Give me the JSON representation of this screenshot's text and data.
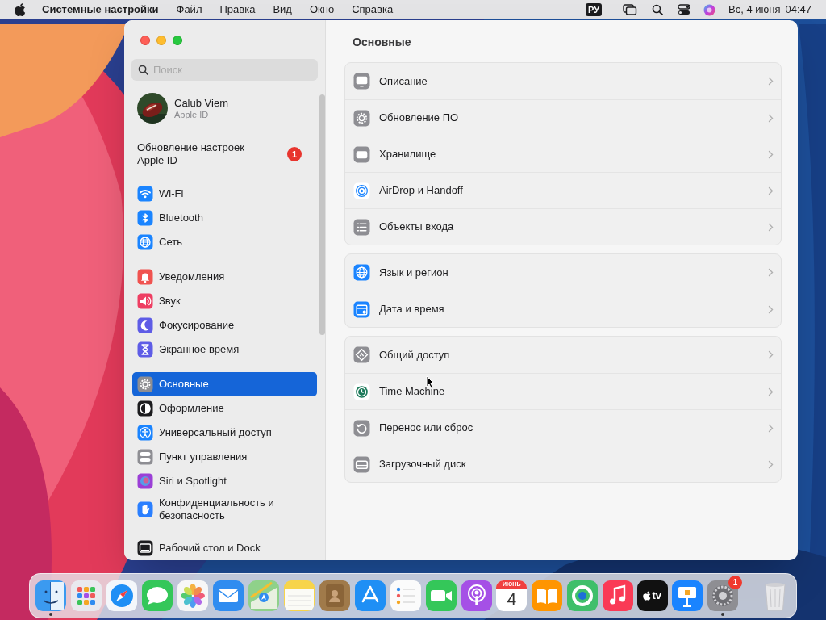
{
  "menu_bar": {
    "app_name": "Системные настройки",
    "menus": [
      "Файл",
      "Правка",
      "Вид",
      "Окно",
      "Справка"
    ],
    "input_source": "РУ",
    "date": "Вс, 4 июня",
    "time": "04:47"
  },
  "sidebar": {
    "search": {
      "placeholder": "Поиск"
    },
    "account": {
      "name": "Calub Viem",
      "subtitle": "Apple ID"
    },
    "notice": {
      "text": "Обновление настроек Apple ID",
      "badge": "1"
    },
    "groups": [
      [
        {
          "label": "Wi-Fi",
          "selected": false,
          "color": "#1a84ff"
        },
        {
          "label": "Bluetooth",
          "selected": false,
          "color": "#1a84ff"
        },
        {
          "label": "Сеть",
          "selected": false,
          "color": "#1a84ff"
        }
      ],
      [
        {
          "label": "Уведомления",
          "selected": false,
          "color": "#f0524f"
        },
        {
          "label": "Звук",
          "selected": false,
          "color": "#ee3e62"
        },
        {
          "label": "Фокусирование",
          "selected": false,
          "color": "#5e5ce6"
        },
        {
          "label": "Экранное время",
          "selected": false,
          "color": "#5e5ce6"
        }
      ],
      [
        {
          "label": "Основные",
          "selected": true,
          "color": "#8e8e93"
        },
        {
          "label": "Оформление",
          "selected": false,
          "color": "#1c1c1e"
        },
        {
          "label": "Универсальный доступ",
          "selected": false,
          "color": "#1a84ff"
        },
        {
          "label": "Пункт управления",
          "selected": false,
          "color": "#8e8e93"
        },
        {
          "label": "Siri и Spotlight",
          "selected": false,
          "color": "#9b3fd6"
        },
        {
          "label": "Конфиденциальность и безопасность",
          "selected": false,
          "color": "#2a7fff"
        }
      ],
      [
        {
          "label": "Рабочий стол и Dock",
          "selected": false,
          "color": "#1c1c1e"
        }
      ]
    ]
  },
  "content": {
    "title": "Основные",
    "groups": [
      [
        {
          "label": "Описание",
          "color": "#8e8e93"
        },
        {
          "label": "Обновление ПО",
          "color": "#8e8e93"
        },
        {
          "label": "Хранилище",
          "color": "#8e8e93"
        },
        {
          "label": "AirDrop и Handoff",
          "color": "#ffffff"
        },
        {
          "label": "Объекты входа",
          "color": "#8e8e93"
        }
      ],
      [
        {
          "label": "Язык и регион",
          "color": "#1a84ff"
        },
        {
          "label": "Дата и время",
          "color": "#1a84ff"
        }
      ],
      [
        {
          "label": "Общий доступ",
          "color": "#8e8e93"
        },
        {
          "label": "Time Machine",
          "color": "#ffffff"
        },
        {
          "label": "Перенос или сброс",
          "color": "#8e8e93"
        },
        {
          "label": "Загрузочный диск",
          "color": "#8e8e93"
        }
      ]
    ]
  },
  "dock": {
    "apps": [
      {
        "kind": "app",
        "color": "#3b9af0",
        "running": true
      },
      {
        "kind": "app",
        "color": "#e9e9ee",
        "running": false
      },
      {
        "kind": "app",
        "color": "#f4f7fb",
        "running": false
      },
      {
        "kind": "app",
        "color": "#34c759",
        "running": false
      },
      {
        "kind": "app",
        "color": "#f7f7f7",
        "running": false
      },
      {
        "kind": "app",
        "color": "#2f8cf0",
        "running": false
      },
      {
        "kind": "app",
        "color": "#8fd18a",
        "running": false
      },
      {
        "kind": "app",
        "color": "#f7d44a",
        "running": false
      },
      {
        "kind": "app",
        "color": "#a07a4a",
        "running": false
      },
      {
        "kind": "app",
        "color": "#1f8ff5",
        "running": false
      },
      {
        "kind": "app",
        "color": "#fbfbfb",
        "running": false
      },
      {
        "kind": "app",
        "color": "#34c759",
        "running": false
      },
      {
        "kind": "app",
        "color": "#a550e6",
        "running": false
      },
      {
        "kind": "calendar",
        "month": "ИЮНЬ",
        "day": "4",
        "running": false
      },
      {
        "kind": "app",
        "color": "#ff9500",
        "running": false
      },
      {
        "kind": "app",
        "color": "#3fbf6a",
        "running": false
      },
      {
        "kind": "app",
        "color": "#fa3a55",
        "running": false
      },
      {
        "kind": "tv",
        "label": "tv",
        "running": false
      },
      {
        "kind": "app",
        "color": "#1a84ff",
        "running": false
      },
      {
        "kind": "app",
        "color": "#8e8e93",
        "running": true,
        "badge": "1"
      },
      {
        "kind": "trash",
        "running": false
      }
    ]
  }
}
